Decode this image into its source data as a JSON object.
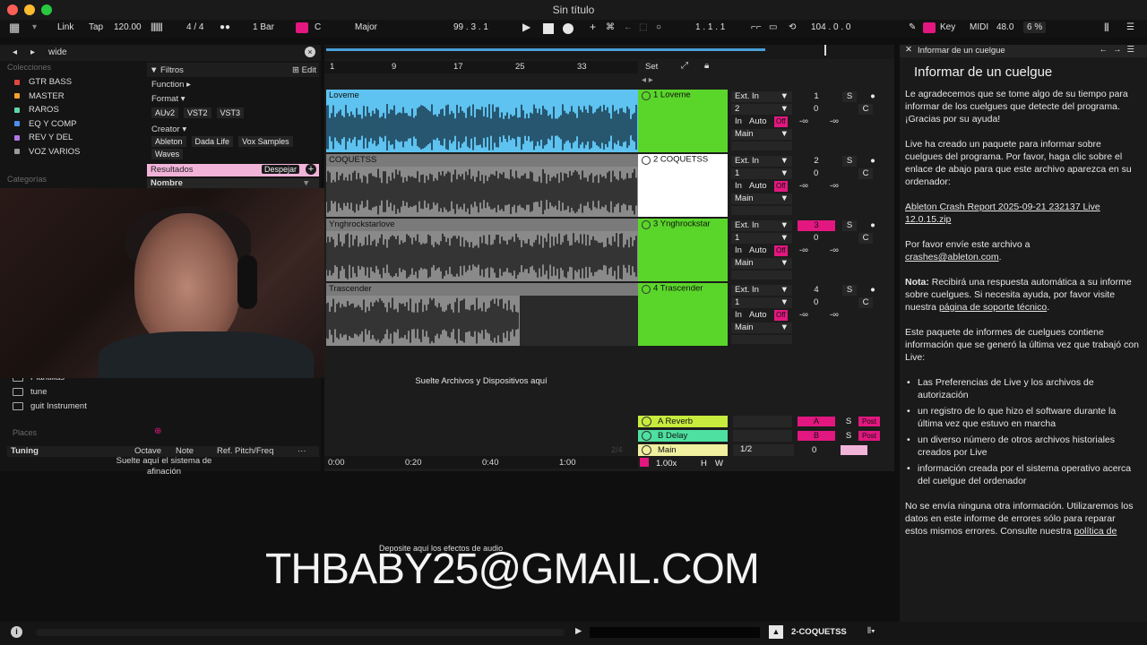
{
  "window": {
    "title": "Sin título"
  },
  "transport": {
    "link": "Link",
    "tap": "Tap",
    "tempo": "120.00",
    "signature": "4 / 4",
    "quantize": "1 Bar",
    "key": "C",
    "scale": "Major",
    "position": "99 .  3 .  1",
    "loop_start": "1 .  1 .  1",
    "loop_length": "104 .  0 .  0",
    "key_label": "Key",
    "midi_label": "MIDI",
    "midi_value": "48.0",
    "cpu": "6 %"
  },
  "browser": {
    "search_value": "wide",
    "collections_title": "Colecciones",
    "collections": [
      {
        "label": "GTR BASS",
        "color": "#e0463a"
      },
      {
        "label": "MASTER",
        "color": "#f2a12b"
      },
      {
        "label": "RAROS",
        "color": "#5fd6a7"
      },
      {
        "label": "EQ Y COMP",
        "color": "#4a8fe8"
      },
      {
        "label": "REV Y DEL",
        "color": "#b377e8"
      },
      {
        "label": "VOZ VARIOS",
        "color": "#9a9a9a"
      }
    ],
    "categories_title": "Categorías",
    "filters_label": "Filtros",
    "edit_label": "Edit",
    "function_label": "Function ▸",
    "format_label": "Format ▾",
    "formats": [
      "AUv2",
      "VST2",
      "VST3"
    ],
    "creator_label": "Creator ▾",
    "creators": [
      "Ableton",
      "Dada Life",
      "Vox Samples",
      "Waves"
    ],
    "results_label": "Resultados",
    "clear_label": "Despejar",
    "name_column": "Nombre",
    "places_items": [
      "Plantillas",
      "tune",
      "guit Instrument"
    ],
    "places_title": "Places",
    "tuning": {
      "title": "Tuning",
      "octave": "Octave",
      "note": "Note",
      "ref": "Ref. Pitch/Freq",
      "drop_hint": "Suelte aquí el sistema de afinación"
    }
  },
  "arrangement": {
    "ruler": [
      "1",
      "9",
      "17",
      "25",
      "33"
    ],
    "set_label": "Set",
    "tracks": [
      {
        "clip": "Loveme",
        "name": "1 Loveme",
        "input": "Ext. In",
        "channel": "2",
        "num": "1",
        "vol": "0",
        "pan": "C",
        "auto": "Auto",
        "off": "Off",
        "inf1": "-∞",
        "inf2": "-∞",
        "out": "Main"
      },
      {
        "clip": "COQUETSS",
        "name": "2 COQUETSS",
        "input": "Ext. In",
        "channel": "1",
        "num": "2",
        "vol": "0",
        "pan": "C",
        "auto": "Auto",
        "off": "Off",
        "inf1": "-∞",
        "inf2": "-∞",
        "out": "Main"
      },
      {
        "clip": "Ynghrockstarlove",
        "name": "3 Ynghrockstar",
        "input": "Ext. In",
        "channel": "1",
        "num": "3",
        "vol": "0",
        "pan": "C",
        "auto": "Auto",
        "off": "Off",
        "inf1": "-∞",
        "inf2": "-∞",
        "out": "Main"
      },
      {
        "clip": "Trascender",
        "name": "4 Trascender",
        "input": "Ext. In",
        "channel": "1",
        "num": "4",
        "vol": "0",
        "pan": "C",
        "auto": "Auto",
        "off": "Off",
        "inf1": "-∞",
        "inf2": "-∞",
        "out": "Main"
      }
    ],
    "in_label": "In",
    "solo": "S",
    "drop_hint": "Suelte Archivos y Dispositivos aquí",
    "returns": [
      {
        "name": "A Reverb",
        "letter": "A",
        "post": "Post",
        "color": "#c7ec3e"
      },
      {
        "name": "B Delay",
        "letter": "B",
        "post": "Post",
        "color": "#4de0a0"
      }
    ],
    "main": {
      "name": "Main",
      "fraction": "1/2",
      "vol": "0",
      "page": "2/4"
    },
    "zoom": "1.00x",
    "h_label": "H",
    "w_label": "W",
    "timeline": [
      "0:00",
      "0:20",
      "0:40",
      "1:00"
    ]
  },
  "info": {
    "header": "Informar de un cuelgue",
    "title": "Informar de un cuelgue",
    "p1": "Le agradecemos que se tome algo de su tiempo para informar de los cuelgues que detecte del programa. ¡Gracias por su ayuda!",
    "p2": "Live ha creado un paquete para informar sobre cuelgues del programa. Por favor, haga clic sobre el enlace de abajo para que este archivo aparezca en su ordenador:",
    "link": "Ableton Crash Report 2025-09-21 232137 Live 12.0.15.zip",
    "p3_prefix": "Por favor envíe este archivo a",
    "email_link": "crashes@ableton.com",
    "note_label": "Nota:",
    "note_text": " Recibirá una respuesta automática a su informe sobre cuelgues. Si necesita ayuda, por favor visite nuestra ",
    "support_link": "página de soporte técnico",
    "p5": "Este paquete de informes de cuelgues contiene información que se generó la última vez que trabajó con Live:",
    "bullets": [
      "Las Preferencias de Live y los archivos de autorización",
      "un registro de lo que hizo el software durante la última vez que estuvo en marcha",
      "un diverso número de otros archivos historiales creados por Live",
      "información creada por el sistema operativo acerca del cuelgue del ordenador"
    ],
    "p6_prefix": "No se envía ninguna otra información. Utilizaremos los datos en este informe de errores sólo para reparar estos mismos errores. Consulte nuestra ",
    "p6_link": "política de"
  },
  "devices": {
    "drop_hint": "Deposite aquí los efectos de audio"
  },
  "overlay": {
    "email": "THBABY25@GMAIL.COM"
  },
  "status": {
    "selected_track": "2-COQUETSS"
  },
  "colors": {
    "accent": "#e2177f",
    "track_green": "#5ad62a",
    "clip_blue": "#5ec3f0"
  }
}
